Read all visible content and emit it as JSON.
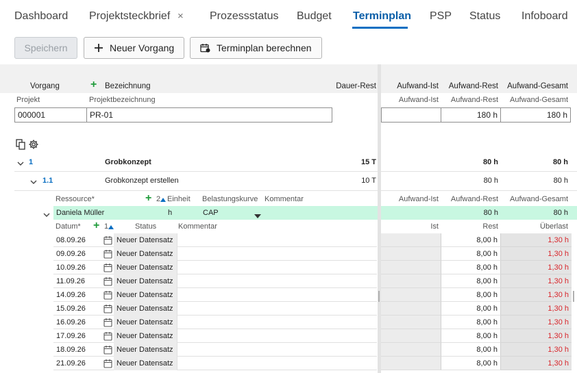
{
  "tabs": [
    {
      "label": "Dashboard"
    },
    {
      "label": "Projektsteckbrief",
      "closable": true
    },
    {
      "label": "Prozessstatus"
    },
    {
      "label": "Budget"
    },
    {
      "label": "Terminplan",
      "active": true
    },
    {
      "label": "PSP"
    },
    {
      "label": "Status"
    },
    {
      "label": "Infoboard"
    }
  ],
  "tab_close_glyph": "×",
  "toolbar": {
    "save_label": "Speichern",
    "new_task_label": "Neuer Vorgang",
    "calc_label": "Terminplan berechnen"
  },
  "columns": {
    "vorgang": "Vorgang",
    "bezeichnung": "Bezeichnung",
    "dauer_rest": "Dauer-Rest",
    "aufwand_ist": "Aufwand-Ist",
    "aufwand_rest": "Aufwand-Rest",
    "aufwand_gesamt": "Aufwand-Gesamt"
  },
  "project_header": {
    "projekt": "Projekt",
    "projektbezeichnung": "Projektbezeichnung",
    "aufwand_ist": "Aufwand-Ist",
    "aufwand_rest": "Aufwand-Rest",
    "aufwand_gesamt": "Aufwand-Gesamt"
  },
  "project": {
    "id": "000001",
    "name": "PR-01",
    "aufwand_ist": "",
    "aufwand_rest": "180 h",
    "aufwand_gesamt": "180 h"
  },
  "tasks": [
    {
      "num": "1",
      "name": "Grobkonzept",
      "dauer": "15 T",
      "rest": "80 h",
      "gesamt": "80 h"
    },
    {
      "num": "1.1",
      "name": "Grobkonzept erstellen",
      "dauer": "10 T",
      "rest": "80 h",
      "gesamt": "80 h"
    }
  ],
  "resource_header": {
    "ressource": "Ressource*",
    "count": "2",
    "einheit": "Einheit",
    "belastungskurve": "Belastungskurve",
    "kommentar": "Kommentar",
    "aufwand_ist": "Aufwand-Ist",
    "aufwand_rest": "Aufwand-Rest",
    "aufwand_gesamt": "Aufwand-Gesamt"
  },
  "resource": {
    "name": "Daniela Müller",
    "einheit": "h",
    "kurve": "CAP",
    "rest": "80 h",
    "gesamt": "80 h"
  },
  "date_header": {
    "datum": "Datum*",
    "count": "1",
    "status": "Status",
    "kommentar": "Kommentar",
    "ist": "Ist",
    "rest": "Rest",
    "ueberlast": "Überlast"
  },
  "date_rows": [
    {
      "datum": "08.09.26",
      "status": "Neuer Datensatz",
      "rest": "8,00 h",
      "ueberlast": "1,30 h"
    },
    {
      "datum": "09.09.26",
      "status": "Neuer Datensatz",
      "rest": "8,00 h",
      "ueberlast": "1,30 h"
    },
    {
      "datum": "10.09.26",
      "status": "Neuer Datensatz",
      "rest": "8,00 h",
      "ueberlast": "1,30 h"
    },
    {
      "datum": "11.09.26",
      "status": "Neuer Datensatz",
      "rest": "8,00 h",
      "ueberlast": "1,30 h"
    },
    {
      "datum": "14.09.26",
      "status": "Neuer Datensatz",
      "rest": "8,00 h",
      "ueberlast": "1,30 h"
    },
    {
      "datum": "15.09.26",
      "status": "Neuer Datensatz",
      "rest": "8,00 h",
      "ueberlast": "1,30 h"
    },
    {
      "datum": "16.09.26",
      "status": "Neuer Datensatz",
      "rest": "8,00 h",
      "ueberlast": "1,30 h"
    },
    {
      "datum": "17.09.26",
      "status": "Neuer Datensatz",
      "rest": "8,00 h",
      "ueberlast": "1,30 h"
    },
    {
      "datum": "18.09.26",
      "status": "Neuer Datensatz",
      "rest": "8,00 h",
      "ueberlast": "1,30 h"
    },
    {
      "datum": "21.09.26",
      "status": "Neuer Datensatz",
      "rest": "8,00 h",
      "ueberlast": "1,30 h"
    }
  ],
  "colors": {
    "accent": "#0a6fc2",
    "highlight_row": "#c8f7e1",
    "overload": "#d8262b",
    "add_green": "#1f9b3a"
  },
  "icons": {
    "add": "plus-icon",
    "calendar_calc": "calendar-calc-icon",
    "copy": "copy-icon",
    "settings": "gear-icon",
    "expand": "chevron-down-icon",
    "sort": "sort-up-icon",
    "date": "calendar-icon",
    "dropdown": "caret-down-icon"
  }
}
